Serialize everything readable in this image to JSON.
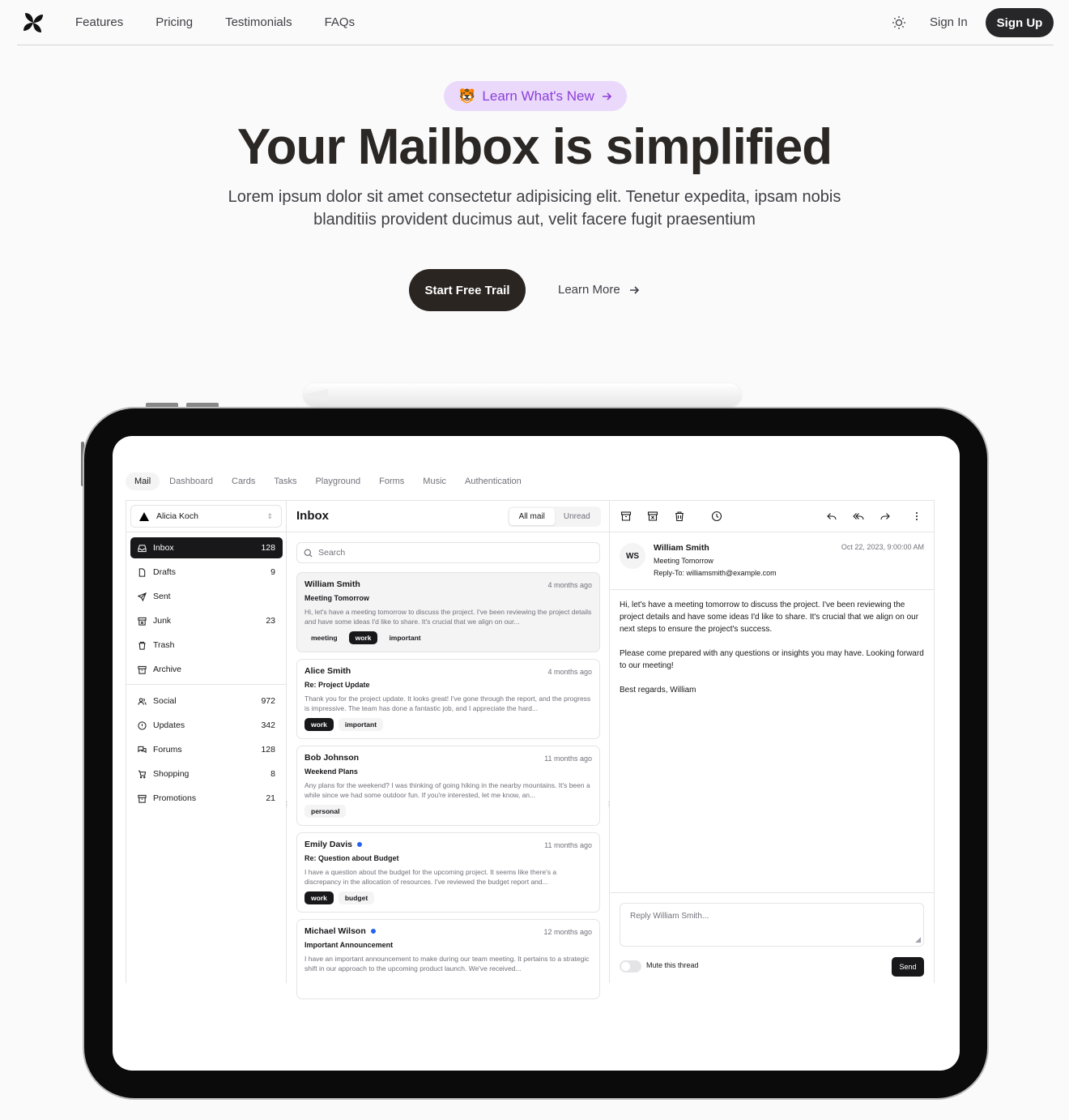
{
  "nav": {
    "links": [
      "Features",
      "Pricing",
      "Testimonials",
      "FAQs"
    ],
    "sign_in": "Sign In",
    "sign_up": "Sign Up"
  },
  "hero": {
    "badge_emoji": "🐯",
    "badge": "Learn What's New",
    "title": "Your Mailbox is simplified",
    "subtitle": "Lorem ipsum dolor sit amet consectetur adipisicing elit. Tenetur expedita, ipsam nobis blanditiis provident ducimus aut, velit facere fugit praesentium",
    "primary_cta": "Start Free Trail",
    "secondary_cta": "Learn More"
  },
  "app": {
    "tabs": [
      "Mail",
      "Dashboard",
      "Cards",
      "Tasks",
      "Playground",
      "Forms",
      "Music",
      "Authentication"
    ],
    "account": "Alicia Koch",
    "folders": [
      {
        "label": "Inbox",
        "count": "128",
        "icon": "inbox-icon"
      },
      {
        "label": "Drafts",
        "count": "9",
        "icon": "file-icon"
      },
      {
        "label": "Sent",
        "count": "",
        "icon": "send-icon"
      },
      {
        "label": "Junk",
        "count": "23",
        "icon": "archive-x-icon"
      },
      {
        "label": "Trash",
        "count": "",
        "icon": "trash-icon"
      },
      {
        "label": "Archive",
        "count": "",
        "icon": "archive-icon"
      }
    ],
    "categories": [
      {
        "label": "Social",
        "count": "972",
        "icon": "users-icon"
      },
      {
        "label": "Updates",
        "count": "342",
        "icon": "alert-circle-icon"
      },
      {
        "label": "Forums",
        "count": "128",
        "icon": "messages-icon"
      },
      {
        "label": "Shopping",
        "count": "8",
        "icon": "cart-icon"
      },
      {
        "label": "Promotions",
        "count": "21",
        "icon": "archive-icon"
      }
    ],
    "inbox_title": "Inbox",
    "toggle": [
      "All mail",
      "Unread"
    ],
    "search_placeholder": "Search",
    "mails": [
      {
        "from": "William Smith",
        "when": "4 months ago",
        "subject": "Meeting Tomorrow",
        "preview": "Hi, let's have a meeting tomorrow to discuss the project. I've been reviewing the project details and have some ideas I'd like to share. It's crucial that we align on our...",
        "tags": [
          "meeting",
          "work",
          "important"
        ],
        "unread": false
      },
      {
        "from": "Alice Smith",
        "when": "4 months ago",
        "subject": "Re: Project Update",
        "preview": "Thank you for the project update. It looks great! I've gone through the report, and the progress is impressive. The team has done a fantastic job, and I appreciate the hard...",
        "tags": [
          "work",
          "important"
        ],
        "unread": false
      },
      {
        "from": "Bob Johnson",
        "when": "11 months ago",
        "subject": "Weekend Plans",
        "preview": "Any plans for the weekend? I was thinking of going hiking in the nearby mountains. It's been a while since we had some outdoor fun. If you're interested, let me know, an...",
        "tags": [
          "personal"
        ],
        "unread": false
      },
      {
        "from": "Emily Davis",
        "when": "11 months ago",
        "subject": "Re: Question about Budget",
        "preview": "I have a question about the budget for the upcoming project. It seems like there's a discrepancy in the allocation of resources. I've reviewed the budget report and...",
        "tags": [
          "work",
          "budget"
        ],
        "unread": true
      },
      {
        "from": "Michael Wilson",
        "when": "12 months ago",
        "subject": "Important Announcement",
        "preview": "I have an important announcement to make during our team meeting. It pertains to a strategic shift in our approach to the upcoming product launch. We've received...",
        "tags": [],
        "unread": true
      }
    ],
    "detail": {
      "initials": "WS",
      "from": "William Smith",
      "subject": "Meeting Tomorrow",
      "reply_to": "Reply-To: williamsmith@example.com",
      "date": "Oct 22, 2023, 9:00:00 AM",
      "body": [
        "Hi, let's have a meeting tomorrow to discuss the project. I've been reviewing the project details and have some ideas I'd like to share. It's crucial that we align on our next steps to ensure the project's success.",
        "Please come prepared with any questions or insights you may have. Looking forward to our meeting!",
        "Best regards, William"
      ],
      "reply_placeholder": "Reply William Smith...",
      "mute_label": "Mute this thread",
      "send_label": "Send"
    }
  }
}
